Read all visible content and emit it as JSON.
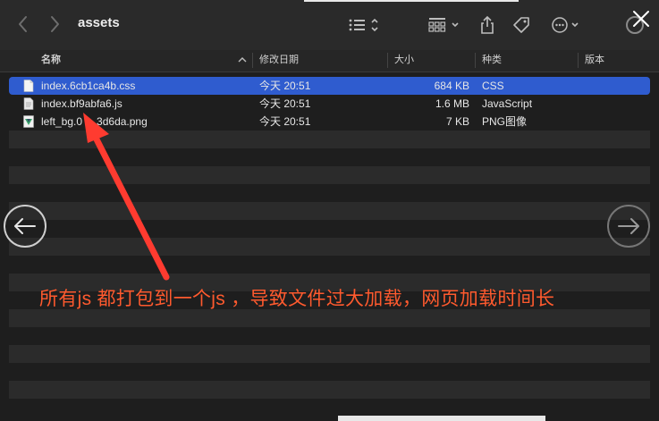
{
  "window": {
    "title": "assets"
  },
  "toolbar": {
    "back_icon": "chevron-left-icon",
    "forward_icon": "chevron-right-icon",
    "view_icon": "list-view-icon",
    "group_icon": "group-grid-icon",
    "share_icon": "share-icon",
    "tag_icon": "tag-icon",
    "more_icon": "ellipsis-circle-icon",
    "close_icon": "close-icon"
  },
  "columns": {
    "name": "名称",
    "modified": "修改日期",
    "size": "大小",
    "kind": "种类",
    "version": "版本"
  },
  "files": [
    {
      "name": "index.6cb1ca4b.css",
      "modified": "今天 20:51",
      "size": "684 KB",
      "kind": "CSS",
      "icon": "css-file-icon",
      "selected": true
    },
    {
      "name": "index.bf9abfa6.js",
      "modified": "今天 20:51",
      "size": "1.6 MB",
      "kind": "JavaScript",
      "icon": "js-file-icon",
      "selected": false
    },
    {
      "name": "left_bg.0",
      "name_tail": "3d6da.png",
      "modified": "今天 20:51",
      "size": "7 KB",
      "kind": "PNG图像",
      "icon": "png-file-icon",
      "selected": false
    }
  ],
  "annotation": {
    "text": "所有js 都打包到一个js ，导致文件过大加载，网页加载时间长",
    "color": "#ff4a2b"
  },
  "overlay_nav": {
    "prev_icon": "arrow-left-circle-icon",
    "next_icon": "arrow-right-circle-icon"
  },
  "colors": {
    "selection": "#2f5ccf",
    "background": "#1e1e1e",
    "stripe": "#2b2b2b"
  }
}
